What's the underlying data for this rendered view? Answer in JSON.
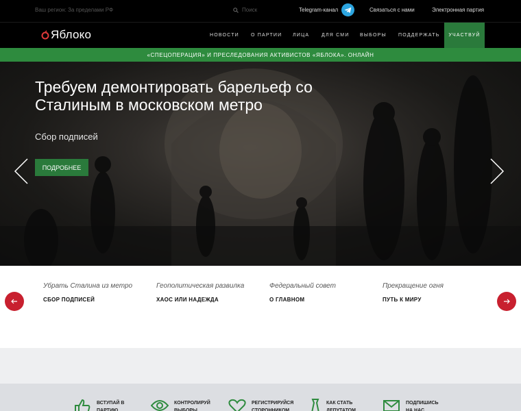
{
  "topbar": {
    "region": "Ваш регион: За пределами РФ",
    "search_placeholder": "Поиск",
    "telegram_label": "Telegram-канал",
    "contact": "Связаться с нами",
    "electronic_party": "Электронная партия"
  },
  "logo": {
    "text": "Яблоко"
  },
  "nav": {
    "items": [
      "новости",
      "о партии",
      "лица",
      "для сми",
      "выборы",
      "поддержать"
    ],
    "cta": "участвуй"
  },
  "banner": {
    "text": "«СПЕЦОПЕРАЦИЯ» И ПРЕСЛЕДОВАНИЯ АКТИВИСТОВ «ЯБЛОКА». ОНЛАЙН"
  },
  "hero": {
    "title": "Требуем демонтировать барельеф со Сталиным в московском метро",
    "subtitle": "Сбор подписей",
    "button": "ПОДРОБНЕЕ"
  },
  "cards": [
    {
      "top": "Убрать Сталина из метро",
      "bottom": "СБОР ПОДПИСЕЙ"
    },
    {
      "top": "Геополитическая развилка",
      "bottom": "ХАОС ИЛИ НАДЕЖДА"
    },
    {
      "top": "Федеральный совет",
      "bottom": "О ГЛАВНОМ"
    },
    {
      "top": "Прекращение огня",
      "bottom": "ПУТЬ К МИРУ"
    }
  ],
  "actions": [
    {
      "label": "ВСТУПАЙ В ПАРТИЮ",
      "icon": "thumbs-up-icon"
    },
    {
      "label": "КОНТРОЛИРУЙ ВЫБОРЫ",
      "icon": "eye-icon"
    },
    {
      "label": "РЕГИСТРИРУЙСЯ СТОРОННИКОМ",
      "icon": "heart-icon"
    },
    {
      "label": "КАК СТАТЬ ДЕПУТАТОМ",
      "icon": "tie-icon"
    },
    {
      "label": "ПОДПИШИСЬ НА НАС",
      "icon": "mail-icon"
    }
  ],
  "colors": {
    "green": "#2e8b3e",
    "red": "#c8202f",
    "telegram": "#2ca5e0"
  }
}
